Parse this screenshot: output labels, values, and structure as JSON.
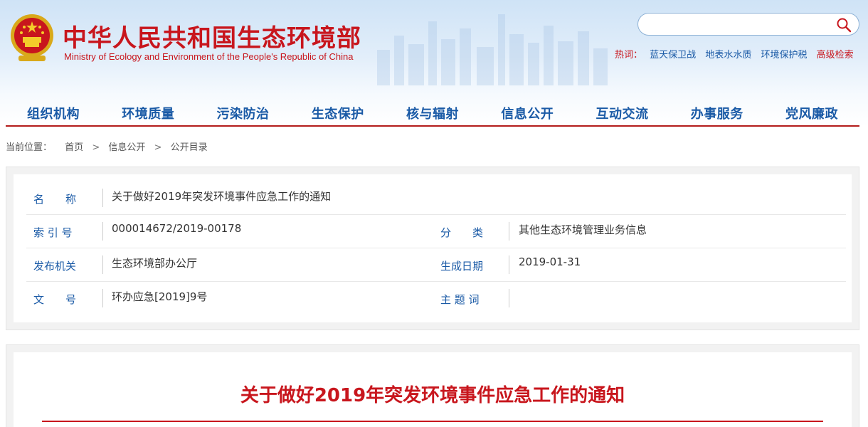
{
  "site": {
    "title": "中华人民共和国生态环境部",
    "subtitle": "Ministry of Ecology and Environment of the People's Republic of China",
    "emblem_icon": "national-emblem-icon",
    "brand_color": "#c8161d",
    "link_color": "#1a5aa6"
  },
  "search": {
    "placeholder": "",
    "value": "",
    "icon": "search-icon"
  },
  "hotwords": {
    "label": "热词：",
    "items": [
      "蓝天保卫战",
      "地表水水质",
      "环境保护税"
    ],
    "advanced": "高级检索"
  },
  "nav": {
    "items": [
      "组织机构",
      "环境质量",
      "污染防治",
      "生态保护",
      "核与辐射",
      "信息公开",
      "互动交流",
      "办事服务",
      "党风廉政"
    ]
  },
  "breadcrumb": {
    "label": "当前位置：",
    "items": [
      "首页",
      "信息公开",
      "公开目录"
    ],
    "separator": ">"
  },
  "meta": {
    "name_label": "名　　称",
    "name_value": "关于做好2019年突发环境事件应急工作的通知",
    "index_label": "索 引 号",
    "index_value": "000014672/2019-00178",
    "category_label": "分　　类",
    "category_value": "其他生态环境管理业务信息",
    "issuer_label": "发布机关",
    "issuer_value": "生态环境部办公厅",
    "date_label": "生成日期",
    "date_value": "2019-01-31",
    "docno_label": "文　　号",
    "docno_value": "环办应急[2019]9号",
    "keywords_label": "主 题 词",
    "keywords_value": ""
  },
  "article": {
    "title": "关于做好2019年突发环境事件应急工作的通知"
  }
}
